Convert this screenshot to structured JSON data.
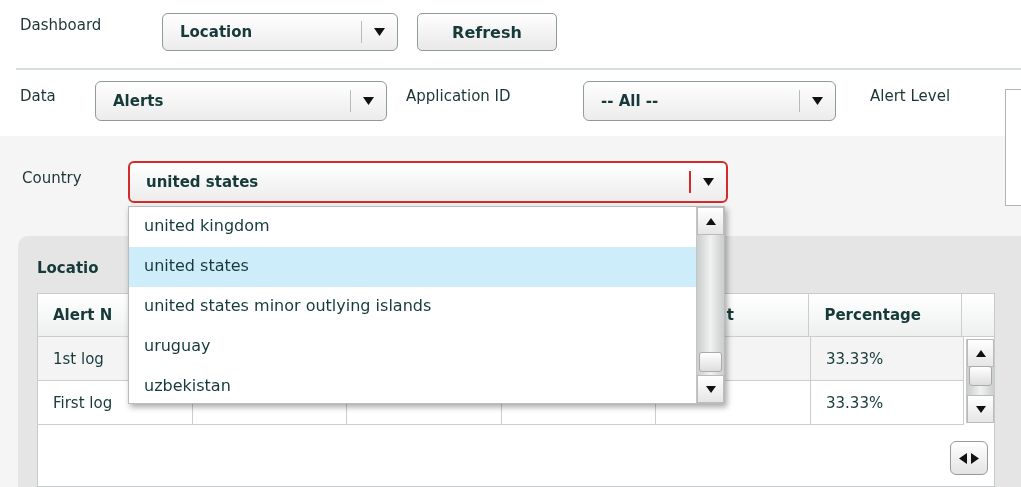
{
  "dashboard": {
    "label": "Dashboard",
    "value": "Location",
    "refresh_button": "Refresh"
  },
  "filters": [
    {
      "label": "Data",
      "value": "Alerts"
    },
    {
      "label": "Application ID",
      "value": "-- All --"
    }
  ],
  "alert_level": {
    "label": "Alert Level"
  },
  "country": {
    "label": "Country",
    "value": "united states",
    "focused": true,
    "open": true,
    "options": [
      {
        "label": "united kingdom",
        "selected": false
      },
      {
        "label": "united states",
        "selected": true
      },
      {
        "label": "united states minor outlying islands",
        "selected": false
      },
      {
        "label": "uruguay",
        "selected": false
      },
      {
        "label": "uzbekistan",
        "selected": false
      }
    ]
  },
  "panel": {
    "title": "Locatio",
    "table": {
      "columns": [
        "Alert N",
        null,
        null,
        null,
        "t",
        "Percentage"
      ],
      "rows": [
        [
          "1st log",
          null,
          null,
          null,
          null,
          "33.33%"
        ],
        [
          "First log",
          null,
          null,
          null,
          null,
          "33.33%"
        ]
      ]
    }
  }
}
